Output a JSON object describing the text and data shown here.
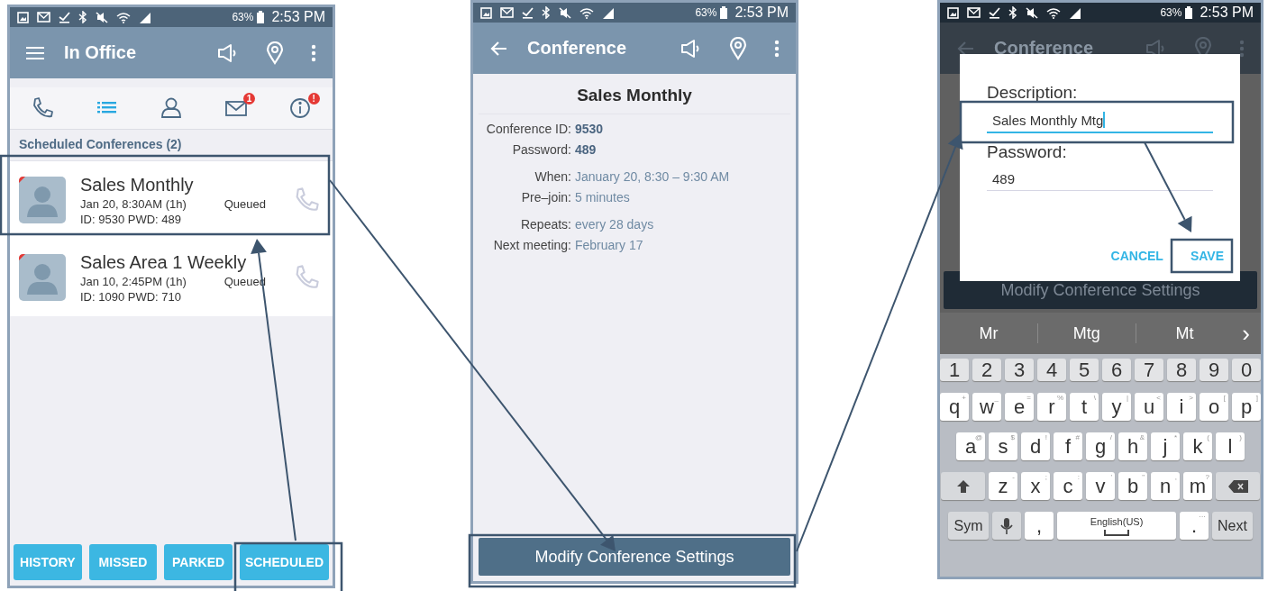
{
  "screen_1": {
    "status_bar": {
      "battery": "63%",
      "time": "2:53 PM"
    },
    "app_bar": {
      "title": "In Office"
    },
    "tabs": [
      {
        "kind": "phone",
        "selected": false
      },
      {
        "kind": "list",
        "selected": true
      },
      {
        "kind": "person",
        "selected": false
      },
      {
        "kind": "mail",
        "selected": false,
        "badge": "1"
      },
      {
        "kind": "info",
        "selected": false,
        "badge": "!"
      }
    ],
    "section_header": "Scheduled Conferences (2)",
    "conferences": [
      {
        "name": "Sales Monthly",
        "when": "Jan 20, 8:30AM (1h)",
        "status": "Queued",
        "credentials": "ID: 9530 PWD: 489"
      },
      {
        "name": "Sales Area 1 Weekly",
        "when": "Jan 10, 2:45PM (1h)",
        "status": "Queued",
        "credentials": "ID: 1090 PWD: 710"
      }
    ],
    "footer_buttons": [
      "HISTORY",
      "MISSED",
      "PARKED",
      "SCHEDULED"
    ]
  },
  "screen_2": {
    "status_bar": {
      "battery": "63%",
      "time": "2:53 PM"
    },
    "app_bar": {
      "title": "Conference"
    },
    "heading": "Sales Monthly",
    "detail_groups": [
      [
        {
          "label": "Conference ID:",
          "value": "9530",
          "bold": true
        },
        {
          "label": "Password:",
          "value": "489",
          "bold": true
        }
      ],
      [
        {
          "label": "When:",
          "value": "January 20, 8:30 – 9:30 AM",
          "bold": false
        },
        {
          "label": "Pre–join:",
          "value": "5 minutes",
          "bold": false
        }
      ],
      [
        {
          "label": "Repeats:",
          "value": "every 28 days",
          "bold": false
        },
        {
          "label": "Next meeting:",
          "value": "February 17",
          "bold": false
        }
      ]
    ],
    "action_button": "Modify Conference Settings"
  },
  "screen_3": {
    "status_bar": {
      "battery": "63%",
      "time": "2:53 PM"
    },
    "app_bar": {
      "title": "Conference"
    },
    "action_button": "Modify Conference Settings",
    "dialog": {
      "fields": [
        {
          "label": "Description:",
          "value": "Sales Monthly Mtg",
          "focused": true
        },
        {
          "label": "Password:",
          "value": "489",
          "focused": false
        }
      ],
      "buttons": [
        "CANCEL",
        "SAVE"
      ]
    },
    "keyboard": {
      "suggestions": [
        "Mr",
        "Mtg",
        "Mt"
      ],
      "more": "›",
      "rows": [
        {
          "keys": [
            {
              "kind": "number",
              "label": "1"
            },
            {
              "kind": "number",
              "label": "2"
            },
            {
              "kind": "number",
              "label": "3"
            },
            {
              "kind": "number",
              "label": "4"
            },
            {
              "kind": "number",
              "label": "5"
            },
            {
              "kind": "number",
              "label": "6"
            },
            {
              "kind": "number",
              "label": "7"
            },
            {
              "kind": "number",
              "label": "8"
            },
            {
              "kind": "number",
              "label": "9"
            },
            {
              "kind": "number",
              "label": "0"
            }
          ]
        },
        {
          "keys": [
            {
              "kind": "letter",
              "label": "q",
              "hint": "+"
            },
            {
              "kind": "letter",
              "label": "w",
              "hint": "_"
            },
            {
              "kind": "letter",
              "label": "e",
              "hint": "="
            },
            {
              "kind": "letter",
              "label": "r",
              "hint": "%"
            },
            {
              "kind": "letter",
              "label": "t",
              "hint": "\\"
            },
            {
              "kind": "letter",
              "label": "y",
              "hint": "|"
            },
            {
              "kind": "letter",
              "label": "u",
              "hint": "<"
            },
            {
              "kind": "letter",
              "label": "i",
              "hint": ">"
            },
            {
              "kind": "letter",
              "label": "o",
              "hint": "["
            },
            {
              "kind": "letter",
              "label": "p",
              "hint": "]"
            }
          ]
        },
        {
          "keys": [
            {
              "kind": "letter",
              "label": "a",
              "hint": "@"
            },
            {
              "kind": "letter",
              "label": "s",
              "hint": "$"
            },
            {
              "kind": "letter",
              "label": "d",
              "hint": "!"
            },
            {
              "kind": "letter",
              "label": "f",
              "hint": "#"
            },
            {
              "kind": "letter",
              "label": "g",
              "hint": "/"
            },
            {
              "kind": "letter",
              "label": "h",
              "hint": "&"
            },
            {
              "kind": "letter",
              "label": "j",
              "hint": "*"
            },
            {
              "kind": "letter",
              "label": "k",
              "hint": "("
            },
            {
              "kind": "letter",
              "label": "l",
              "hint": ")"
            }
          ]
        },
        {
          "keys": [
            {
              "kind": "shift"
            },
            {
              "kind": "letter",
              "label": "z",
              "hint": "-"
            },
            {
              "kind": "letter",
              "label": "x",
              "hint": ";"
            },
            {
              "kind": "letter",
              "label": "c",
              "hint": ":"
            },
            {
              "kind": "letter",
              "label": "v",
              "hint": "'"
            },
            {
              "kind": "letter",
              "label": "b",
              "hint": "\""
            },
            {
              "kind": "letter",
              "label": "n",
              "hint": ","
            },
            {
              "kind": "letter",
              "label": "m",
              "hint": "?"
            },
            {
              "kind": "backspace"
            }
          ]
        },
        {
          "keys": [
            {
              "kind": "sym",
              "label": "Sym"
            },
            {
              "kind": "mic"
            },
            {
              "kind": "char",
              "label": ","
            },
            {
              "kind": "space",
              "label": "English(US)"
            },
            {
              "kind": "char",
              "label": ".",
              "hint": "···"
            },
            {
              "kind": "action",
              "label": "Next"
            }
          ]
        }
      ]
    }
  }
}
